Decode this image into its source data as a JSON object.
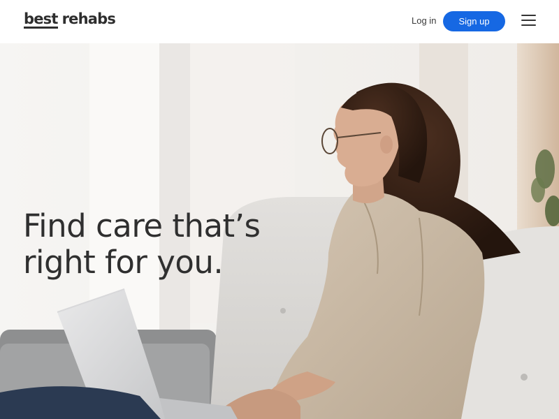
{
  "header": {
    "logo": {
      "part1": "best",
      "part2": "rehabs"
    },
    "login_label": "Log in",
    "signup_label": "Sign up",
    "menu_icon": "hamburger-menu-icon"
  },
  "hero": {
    "headline_line1": "Find care that’s",
    "headline_line2": "right for you."
  },
  "colors": {
    "accent": "#1668e3",
    "text": "#2f2f2f"
  }
}
